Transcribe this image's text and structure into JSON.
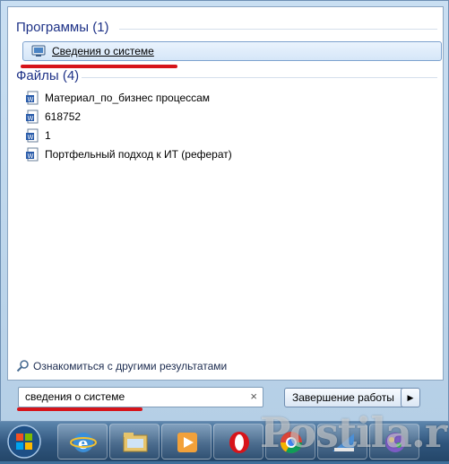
{
  "results": {
    "programs_title": "Программы (1)",
    "programs": [
      {
        "label": "Сведения о системе",
        "icon": "system-info-icon"
      }
    ],
    "files_title": "Файлы (4)",
    "files": [
      {
        "label": "Материал_по_бизнес процессам",
        "icon": "word-doc-icon"
      },
      {
        "label": "618752",
        "icon": "word-doc-icon"
      },
      {
        "label": "1",
        "icon": "word-doc-icon"
      },
      {
        "label": "Портфельный подход к ИТ (реферат)",
        "icon": "word-doc-icon"
      }
    ],
    "more_results": "Ознакомиться с другими результатами"
  },
  "search": {
    "value": "сведения о системе",
    "clear_glyph": "×"
  },
  "shutdown": {
    "label": "Завершение работы",
    "arrow": "▶"
  },
  "watermark": "Postila.ru",
  "taskbar": {
    "icons": [
      "start-orb",
      "internet-explorer",
      "windows-explorer",
      "media-player",
      "opera",
      "chrome",
      "paint",
      "games"
    ]
  },
  "colors": {
    "highlight": "#d6141a",
    "group_title": "#1e3287"
  }
}
